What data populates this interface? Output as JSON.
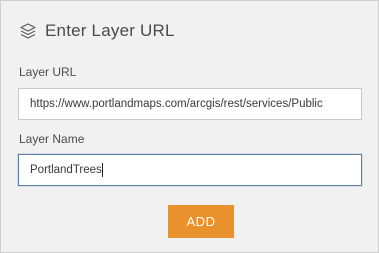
{
  "header": {
    "title": "Enter Layer URL",
    "icon": "layers-icon"
  },
  "layer_url": {
    "label": "Layer URL",
    "value": "https://www.portlandmaps.com/arcgis/rest/services/Public"
  },
  "layer_name": {
    "label": "Layer Name",
    "value": "PortlandTrees"
  },
  "add_button": {
    "label": "ADD"
  },
  "colors": {
    "accent": "#e8912d",
    "panel_background": "#f1f1f1",
    "focus_border": "#5a7fa6"
  }
}
